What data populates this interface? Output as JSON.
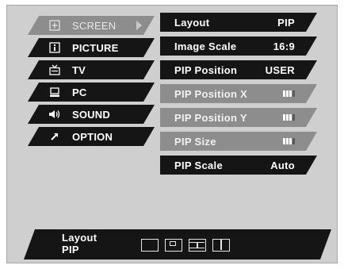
{
  "menu": {
    "items": [
      {
        "label": "SCREEN",
        "icon": "screen-plus-icon",
        "active": true
      },
      {
        "label": "PICTURE",
        "icon": "picture-icon"
      },
      {
        "label": "TV",
        "icon": "tv-icon"
      },
      {
        "label": "PC",
        "icon": "pc-monitor-icon"
      },
      {
        "label": "SOUND",
        "icon": "speaker-icon"
      },
      {
        "label": "OPTION",
        "icon": "option-arrow-icon"
      }
    ]
  },
  "submenu": {
    "items": [
      {
        "label": "Layout",
        "value": "PIP"
      },
      {
        "label": "Image Scale",
        "value": "16:9"
      },
      {
        "label": "PIP Position",
        "value": "USER"
      },
      {
        "label": "PIP Position X",
        "level": 0.7
      },
      {
        "label": "PIP Position Y",
        "level": 0.7
      },
      {
        "label": "PIP Size",
        "level": 0.7
      },
      {
        "label": "PIP Scale",
        "value": "Auto"
      }
    ]
  },
  "info": {
    "title": "Layout",
    "value": "PIP",
    "layout_icons": [
      "single-screen-icon",
      "pip-screen-icon",
      "split-box-screen-icon",
      "split-screen-icon"
    ]
  },
  "colors": {
    "panel": "#cfcfcf",
    "item_dark": "#151515",
    "item_dim": "#8d8d8d",
    "text": "#ffffff"
  }
}
